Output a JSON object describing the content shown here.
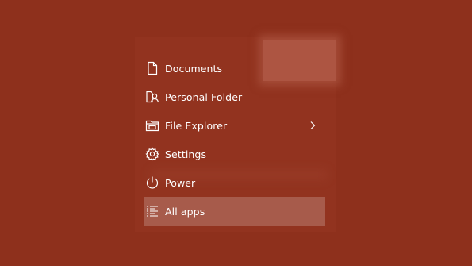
{
  "start_menu": {
    "items": [
      {
        "label": "Documents",
        "icon": "document-icon"
      },
      {
        "label": "Personal Folder",
        "icon": "personal-folder-icon"
      },
      {
        "label": "File Explorer",
        "icon": "file-explorer-icon",
        "has_submenu": true
      },
      {
        "label": "Settings",
        "icon": "settings-gear-icon"
      },
      {
        "label": "Power",
        "icon": "power-icon"
      },
      {
        "label": "All apps",
        "icon": "all-apps-list-icon",
        "selected": true
      }
    ]
  },
  "colors": {
    "accent_background": "#8e301c",
    "highlight": "#ad5542",
    "text": "#ffffff"
  }
}
